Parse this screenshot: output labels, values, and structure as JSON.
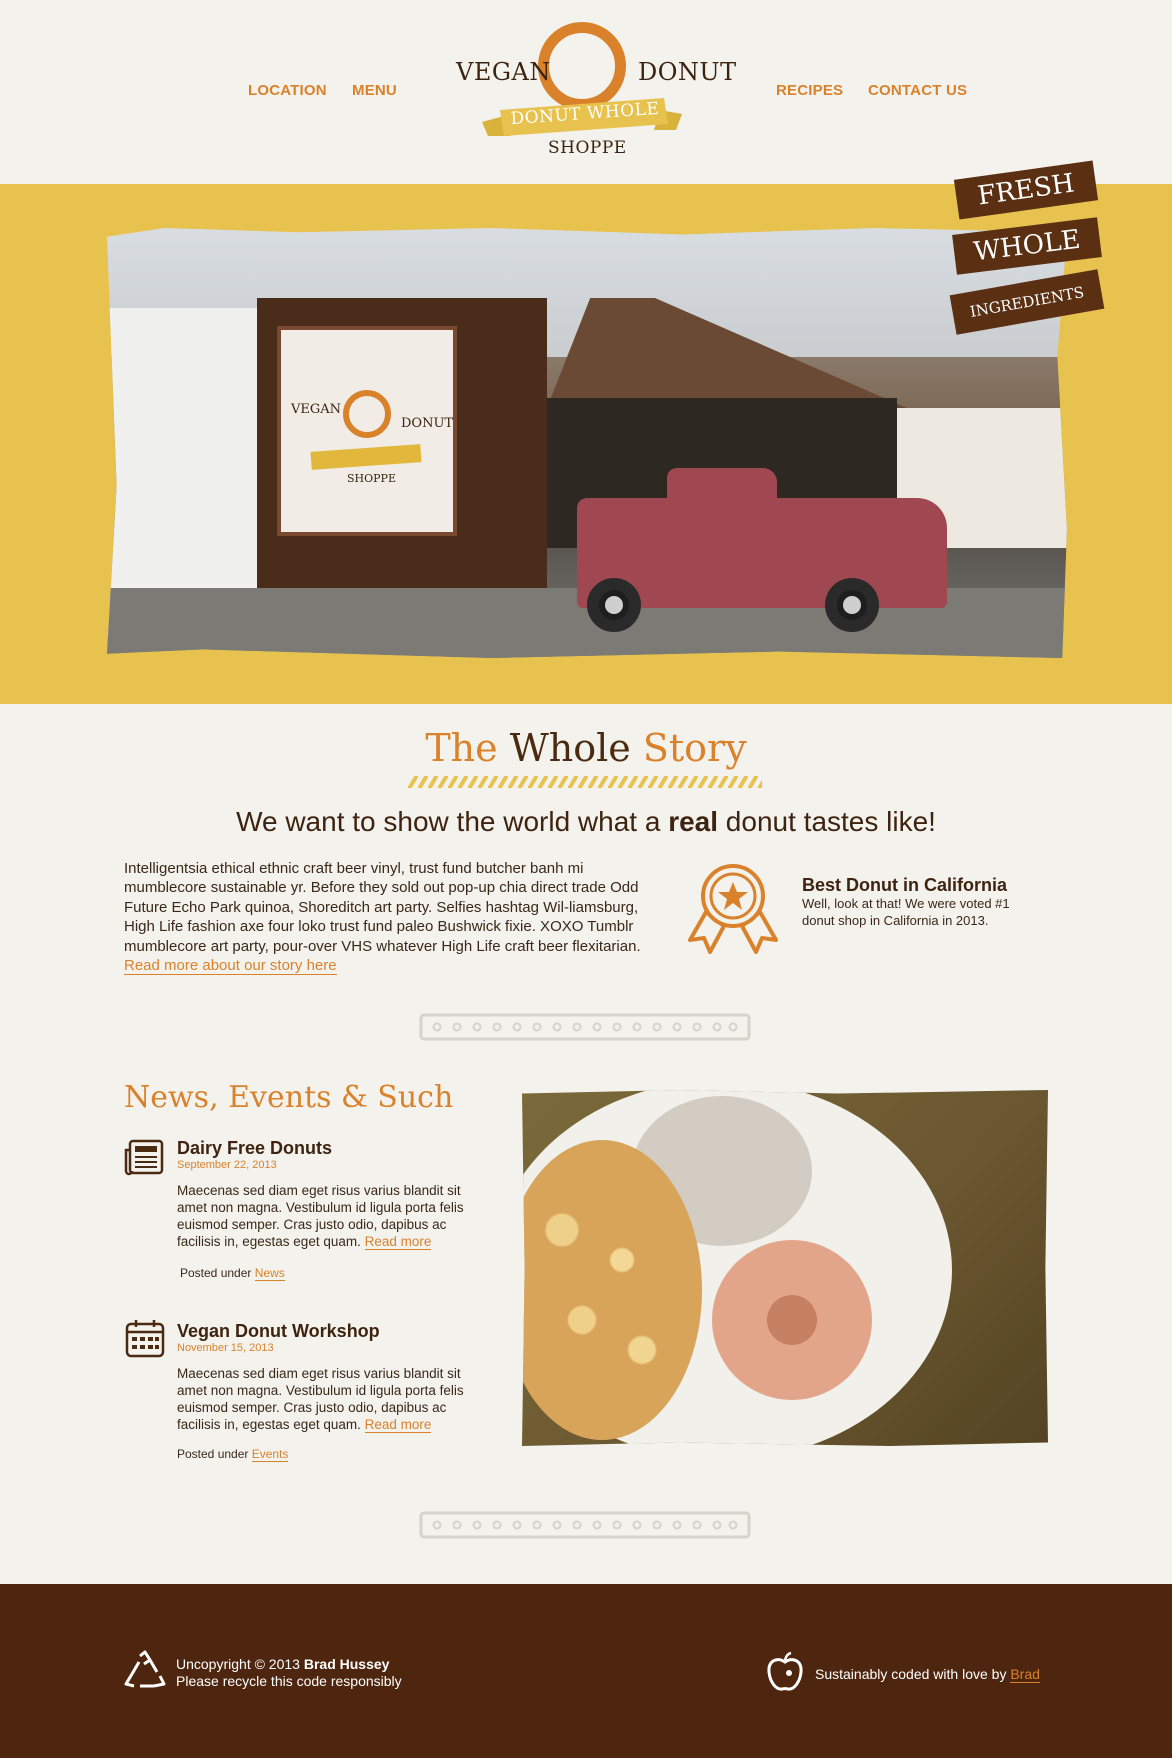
{
  "nav": {
    "location": "LOCATION",
    "menu": "MENU",
    "recipes": "RECIPES",
    "contact": "CONTACT US"
  },
  "logo": {
    "vegan": "VEGAN",
    "donut": "DONUT",
    "ribbon": "DONUT WHOLE",
    "shoppe": "SHOPPE"
  },
  "hero": {
    "badges": [
      "FRESH",
      "WHOLE",
      "INGREDIENTS"
    ]
  },
  "story": {
    "title_a": "The ",
    "title_b": "Whole",
    "title_c": " Story",
    "subtitle_a": "We want to show the world what a ",
    "subtitle_bold": "real",
    "subtitle_b": " donut tastes like!",
    "body": "Intelligentsia ethical ethnic craft beer vinyl, trust fund butcher banh mi mumblecore sustainable yr. Before they sold out pop-up chia direct trade Odd Future Echo Park quinoa, Shoreditch art party. Selfies hashtag Wil-liamsburg, High Life fashion axe four loko trust fund paleo Bushwick fixie. XOXO Tumblr mumblecore art party, pour-over VHS whatever High Life craft beer flexitarian. ",
    "read_more": "Read more about our story here",
    "award_title": "Best Donut in California",
    "award_text": "Well, look at that! We were voted #1 donut shop in California in 2013."
  },
  "news": {
    "title": "News, Events & Such",
    "events": [
      {
        "icon": "newspaper-icon",
        "title": "Dairy Free Donuts",
        "date": "September 22, 2013",
        "body": "Maecenas sed diam eget risus varius blandit sit amet non magna. Vestibulum id ligula porta felis euismod semper. Cras justo odio, dapibus ac facilisis in, egestas eget quam. ",
        "read_more": "Read more",
        "posted": "Posted under ",
        "category": "News"
      },
      {
        "icon": "calendar-icon",
        "title": "Vegan Donut Workshop",
        "date": "November 15, 2013",
        "body": "Maecenas sed diam eget risus varius blandit sit amet non magna. Vestibulum id ligula porta felis euismod semper. Cras justo odio, dapibus ac facilisis in, egestas eget quam. ",
        "read_more": "Read more",
        "posted": "Posted under ",
        "category": "Events"
      }
    ]
  },
  "footer": {
    "copy_a": "Uncopyright © 2013 ",
    "copy_name": "Brad Hussey",
    "copy_line2": "Please recycle this code responsibly",
    "love_text": "Sustainably coded with love by ",
    "love_link": "Brad"
  },
  "colors": {
    "accent": "#d9822b",
    "hero_bg": "#e8c24f",
    "footer_bg": "#4e260f",
    "dark_brown": "#4a2a10",
    "page_bg": "#f4f2ed"
  }
}
